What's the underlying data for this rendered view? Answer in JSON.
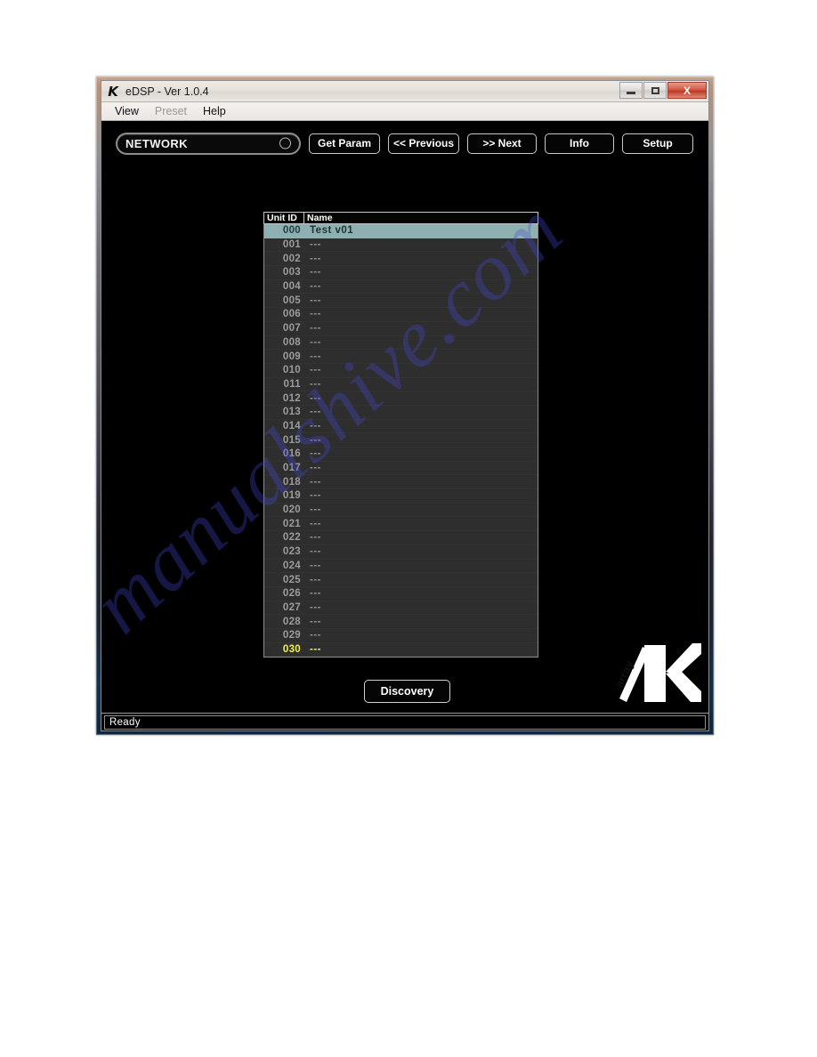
{
  "window": {
    "title": "eDSP - Ver 1.0.4",
    "app_icon": "K",
    "controls": {
      "minimize": "",
      "maximize": "",
      "close": "X"
    }
  },
  "menubar": {
    "items": [
      {
        "label": "View",
        "disabled": false
      },
      {
        "label": "Preset",
        "disabled": true
      },
      {
        "label": "Help",
        "disabled": false
      }
    ]
  },
  "toolbar": {
    "network_label": "NETWORK",
    "buttons": [
      {
        "label": "Get Param"
      },
      {
        "label": "<< Previous"
      },
      {
        "label": ">> Next"
      },
      {
        "label": "Info"
      },
      {
        "label": "Setup"
      }
    ]
  },
  "unit_list": {
    "columns": [
      "Unit ID",
      "Name"
    ],
    "rows": [
      {
        "id": "000",
        "name": "Test v01",
        "state": "selected"
      },
      {
        "id": "001",
        "name": "---",
        "state": "normal"
      },
      {
        "id": "002",
        "name": "---",
        "state": "normal"
      },
      {
        "id": "003",
        "name": "---",
        "state": "normal"
      },
      {
        "id": "004",
        "name": "---",
        "state": "normal"
      },
      {
        "id": "005",
        "name": "---",
        "state": "normal"
      },
      {
        "id": "006",
        "name": "---",
        "state": "normal"
      },
      {
        "id": "007",
        "name": "---",
        "state": "normal"
      },
      {
        "id": "008",
        "name": "---",
        "state": "normal"
      },
      {
        "id": "009",
        "name": "---",
        "state": "normal"
      },
      {
        "id": "010",
        "name": "---",
        "state": "normal"
      },
      {
        "id": "011",
        "name": "---",
        "state": "normal"
      },
      {
        "id": "012",
        "name": "---",
        "state": "normal"
      },
      {
        "id": "013",
        "name": "---",
        "state": "normal"
      },
      {
        "id": "014",
        "name": "---",
        "state": "normal"
      },
      {
        "id": "015",
        "name": "---",
        "state": "normal"
      },
      {
        "id": "016",
        "name": "---",
        "state": "normal"
      },
      {
        "id": "017",
        "name": "---",
        "state": "normal"
      },
      {
        "id": "018",
        "name": "---",
        "state": "normal"
      },
      {
        "id": "019",
        "name": "---",
        "state": "normal"
      },
      {
        "id": "020",
        "name": "---",
        "state": "normal"
      },
      {
        "id": "021",
        "name": "---",
        "state": "normal"
      },
      {
        "id": "022",
        "name": "---",
        "state": "normal"
      },
      {
        "id": "023",
        "name": "---",
        "state": "normal"
      },
      {
        "id": "024",
        "name": "---",
        "state": "normal"
      },
      {
        "id": "025",
        "name": "---",
        "state": "normal"
      },
      {
        "id": "026",
        "name": "---",
        "state": "normal"
      },
      {
        "id": "027",
        "name": "---",
        "state": "normal"
      },
      {
        "id": "028",
        "name": "---",
        "state": "normal"
      },
      {
        "id": "029",
        "name": "---",
        "state": "normal"
      },
      {
        "id": "030",
        "name": "---",
        "state": "highlight"
      }
    ]
  },
  "actions": {
    "discovery_label": "Discovery"
  },
  "brand": {
    "logo_letter": "K",
    "logo_word": "array"
  },
  "statusbar": {
    "text": "Ready"
  },
  "watermark": {
    "text": "manualshive.com"
  },
  "colors": {
    "selection": "#8fb0b0",
    "highlight_row": "#f2f24a",
    "list_background": "#2e2e2e",
    "client_background": "#000000",
    "close_button": "#bb3a24"
  }
}
